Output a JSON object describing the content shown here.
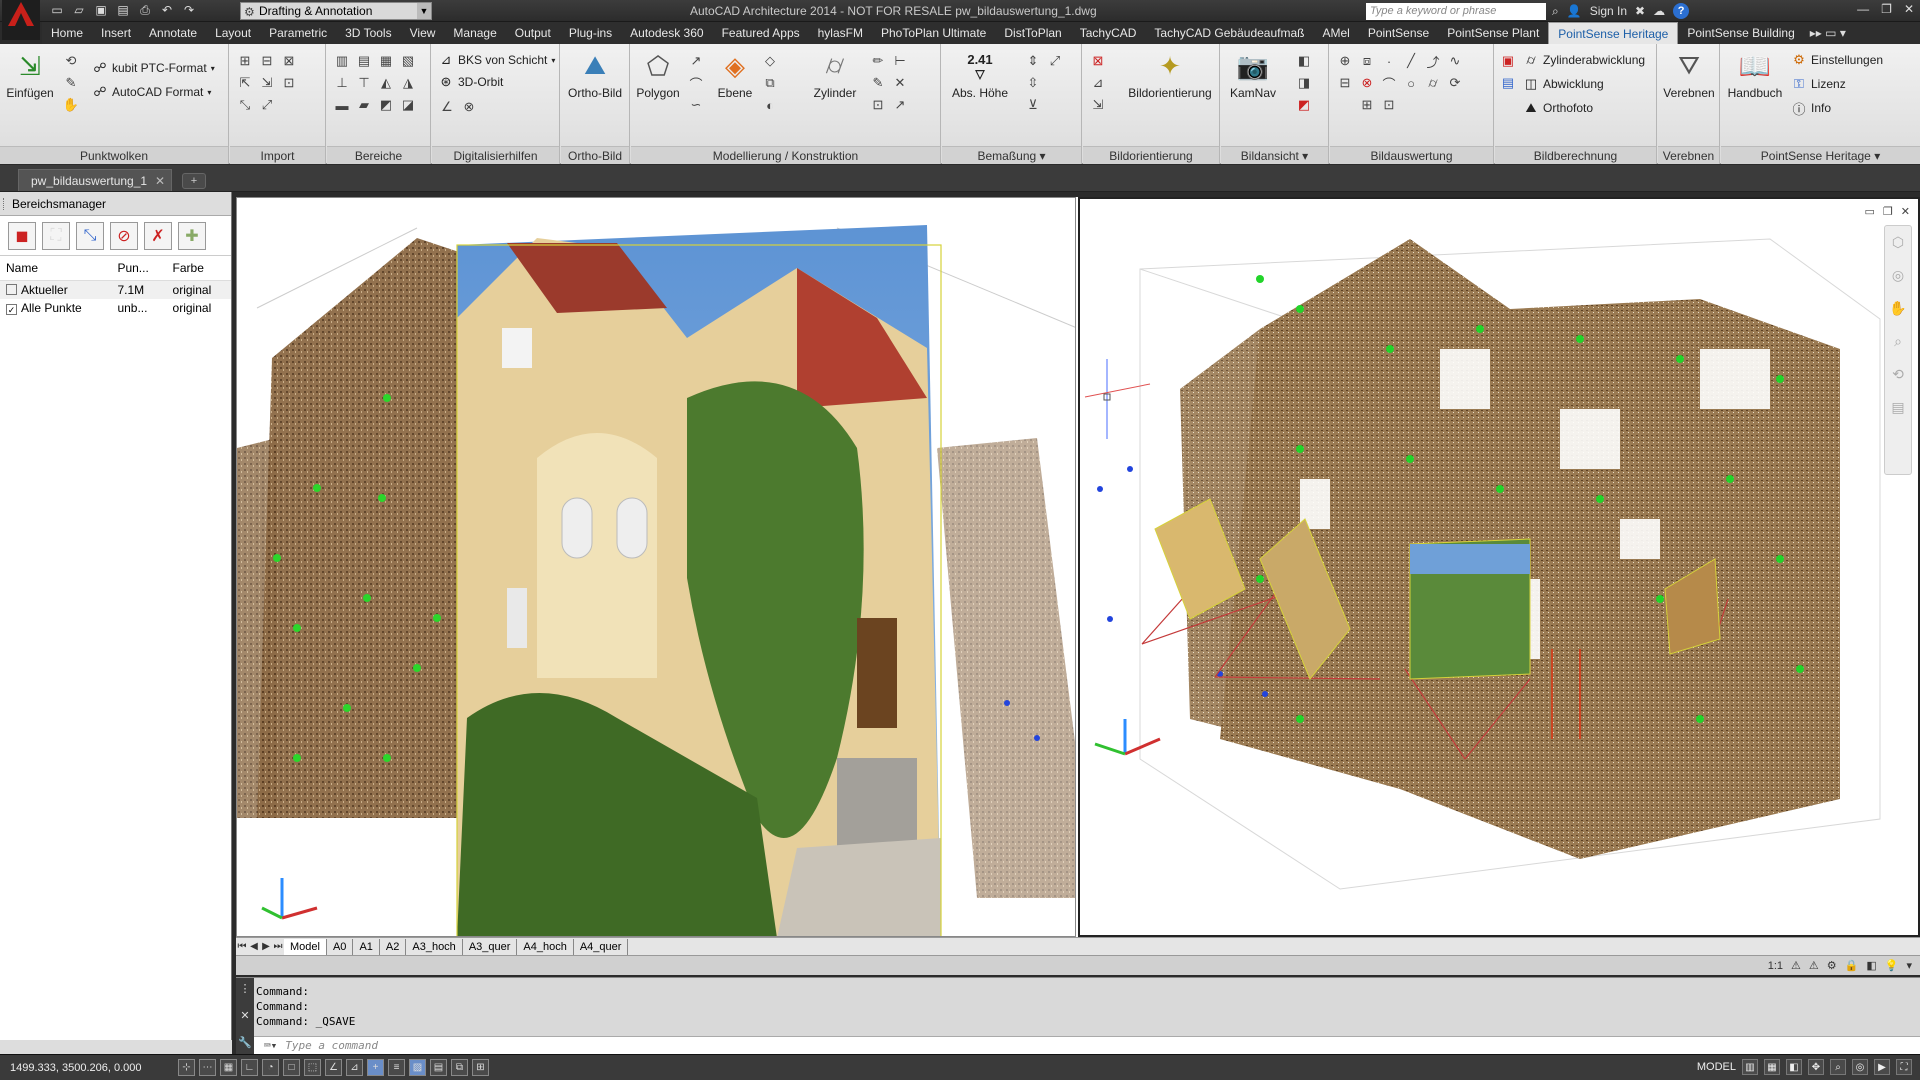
{
  "app": {
    "title": "AutoCAD Architecture 2014 - NOT FOR RESALE    pw_bildauswertung_1.dwg",
    "workspace": "Drafting & Annotation",
    "search_placeholder": "Type a keyword or phrase",
    "sign_in": "Sign In"
  },
  "menu": {
    "tabs": [
      "Home",
      "Insert",
      "Annotate",
      "Layout",
      "Parametric",
      "3D Tools",
      "View",
      "Manage",
      "Output",
      "Plug-ins",
      "Autodesk 360",
      "Featured Apps",
      "hylasFM",
      "PhoToPlan Ultimate",
      "DistToPlan",
      "TachyCAD",
      "TachyCAD Gebäudeaufmaß",
      "AMel",
      "PointSense",
      "PointSense Plant",
      "PointSense Heritage",
      "PointSense Building"
    ],
    "active": "PointSense Heritage"
  },
  "ribbon": {
    "panels": {
      "punktwolken": "Punktwolken",
      "import": "Import",
      "bereiche": "Bereiche",
      "digitalisierhilfen": "Digitalisierhilfen",
      "orthobild": "Ortho-Bild",
      "modellierung": "Modellierung / Konstruktion",
      "bemassung": "Bemaßung",
      "bildorientierung": "Bildorientierung",
      "bildansicht": "Bildansicht",
      "bildauswertung": "Bildauswertung",
      "bildberechnung": "Bildberechnung",
      "verebnen": "Verebnen",
      "heritage": "PointSense Heritage"
    },
    "buttons": {
      "einfuegen": "Einfügen",
      "kubit_ptc": "kubit PTC-Format",
      "autocad_format": "AutoCAD Format",
      "bks_von_schicht": "BKS von Schicht",
      "orbit_3d": "3D-Orbit",
      "ortho_bild": "Ortho-Bild",
      "polygon": "Polygon",
      "ebene": "Ebene",
      "zylinder": "Zylinder",
      "abs_hoehe": "Abs. Höhe",
      "abs_hoehe_value": "2.41",
      "bildorientierung": "Bildorientierung",
      "kamnav": "KamNav",
      "zylinderabwicklung": "Zylinderabwicklung",
      "abwicklung": "Abwicklung",
      "orthofoto": "Orthofoto",
      "verebnen": "Verebnen",
      "handbuch": "Handbuch",
      "einstellungen": "Einstellungen",
      "lizenz": "Lizenz",
      "info": "Info"
    }
  },
  "doc": {
    "tab": "pw_bildauswertung_1"
  },
  "bereichsmanager": {
    "title": "Bereichsmanager",
    "columns": [
      "Name",
      "Pun...",
      "Farbe"
    ],
    "rows": [
      {
        "checked": false,
        "name": "Aktueller",
        "points": "7.1M",
        "color": "original"
      },
      {
        "checked": true,
        "name": "Alle Punkte",
        "points": "unb...",
        "color": "original"
      }
    ]
  },
  "layouts": {
    "tabs": [
      "Model",
      "A0",
      "A1",
      "A2",
      "A3_hoch",
      "A3_quer",
      "A4_hoch",
      "A4_quer"
    ],
    "active": "Model"
  },
  "command": {
    "history": [
      "Command:",
      "Command:",
      "Command:  _QSAVE"
    ],
    "placeholder": "Type a command"
  },
  "status": {
    "coords": "1499.333, 3500.206, 0.000",
    "model": "MODEL",
    "scale": "1:1"
  }
}
